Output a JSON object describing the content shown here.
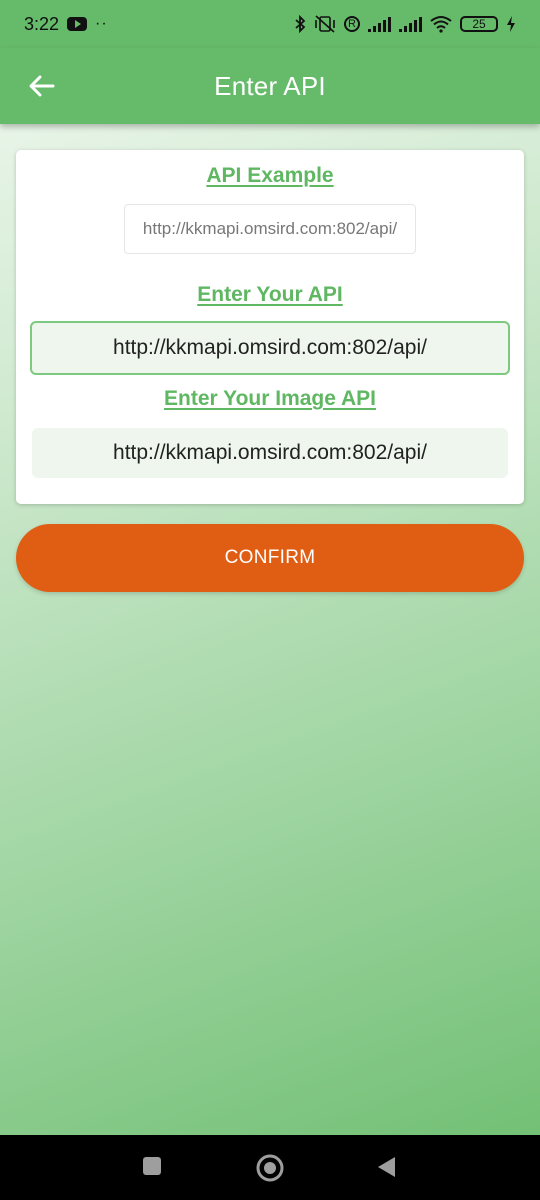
{
  "status_bar": {
    "time": "3:22",
    "notification_dots": "··",
    "battery_level": "25",
    "icons": [
      "youtube-icon",
      "bluetooth-icon",
      "vibrate-off-icon",
      "registered-icon",
      "signal-icon",
      "signal-icon",
      "wifi-icon",
      "battery-icon",
      "charging-icon"
    ]
  },
  "app_bar": {
    "title": "Enter API",
    "back_icon": "arrow-left-icon",
    "color": "#66bb6a"
  },
  "card": {
    "example_title": "API Example",
    "example_value": "http://kkmapi.omsird.com:802/api/",
    "api_title": "Enter Your API",
    "api_value": "http://kkmapi.omsird.com:802/api/",
    "image_api_title": "Enter Your Image API",
    "image_api_value": "http://kkmapi.omsird.com:802/api/",
    "accent_color": "#5fb762"
  },
  "confirm": {
    "label": "CONFIRM",
    "color": "#e05e14"
  },
  "nav_bar": {
    "icons": [
      "recents-square-icon",
      "home-circle-icon",
      "back-triangle-icon"
    ]
  }
}
